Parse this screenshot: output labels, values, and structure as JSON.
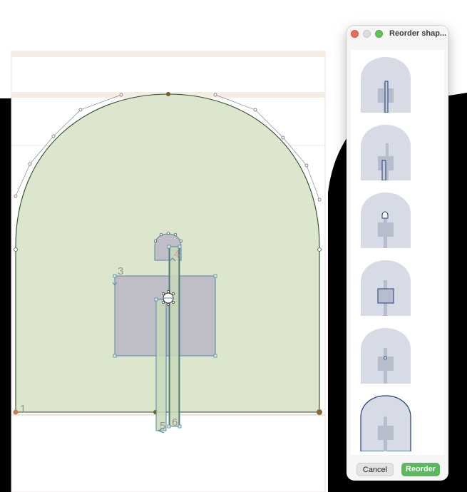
{
  "canvas": {
    "point_labels": [
      "1",
      "3",
      "4",
      "5",
      "6"
    ],
    "colors": {
      "arch_fill": "#dce6cd",
      "arch_stroke": "#2f4a2c",
      "rect_fill": "#bfbdc8",
      "selection": "#4f8ca1",
      "black_panel": "#000000"
    }
  },
  "panel": {
    "title": "Reorder shap...",
    "items": [
      {
        "name": "thin-tall-bar-shape",
        "selected": false
      },
      {
        "name": "short-bar-shape",
        "selected": false
      },
      {
        "name": "small-arch-shape",
        "selected": false
      },
      {
        "name": "rectangle-shape",
        "selected": false
      },
      {
        "name": "tiny-circle-shape",
        "selected": false
      },
      {
        "name": "large-arch-shape",
        "selected": true
      }
    ],
    "buttons": {
      "cancel": "Cancel",
      "reorder": "Reorder"
    },
    "colors": {
      "thumb_fill": "#d6dbe6",
      "thumb_outline": "#1f3f7a",
      "primary": "#5bb85d"
    }
  }
}
